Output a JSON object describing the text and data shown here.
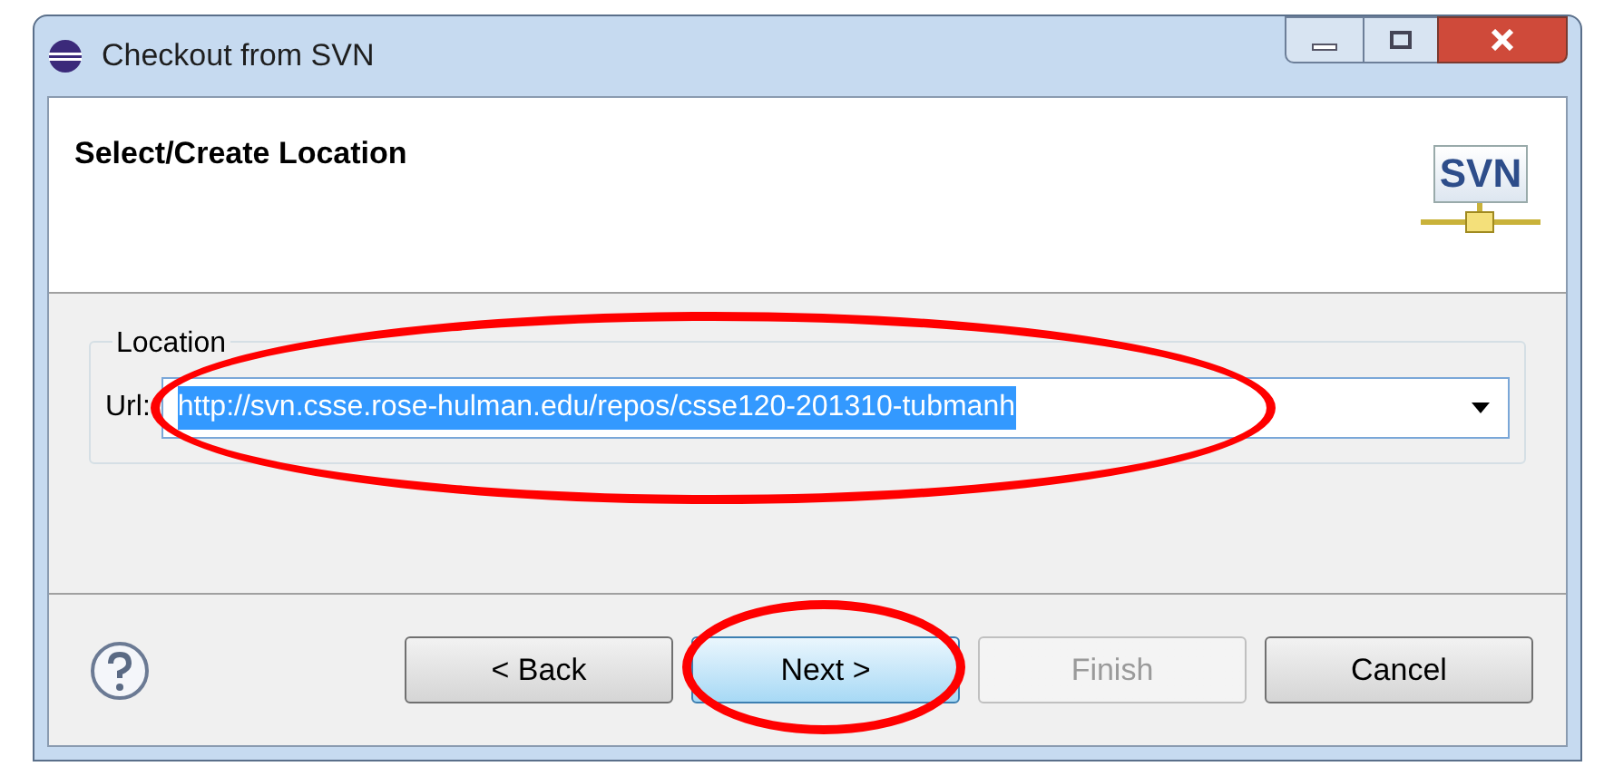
{
  "window": {
    "title": "Checkout from SVN"
  },
  "header": {
    "title": "Select/Create Location",
    "logo_text": "SVN"
  },
  "location": {
    "group_label": "Location",
    "url_label": "Url:",
    "url_value": "http://svn.csse.rose-hulman.edu/repos/csse120-201310-tubmanh",
    "url_selected": true,
    "highlighted": true
  },
  "buttons": [
    {
      "label": "< Back",
      "disabled": false,
      "default": false,
      "highlighted": false
    },
    {
      "label": "Next >",
      "disabled": false,
      "default": true,
      "highlighted": true
    },
    {
      "label": "Finish",
      "disabled": true,
      "default": false,
      "highlighted": false
    },
    {
      "label": "Cancel",
      "disabled": false,
      "default": false,
      "highlighted": false
    }
  ]
}
